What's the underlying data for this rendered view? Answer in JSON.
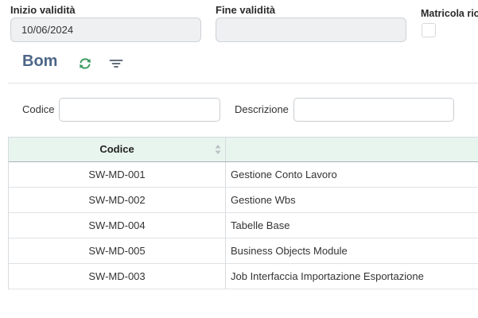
{
  "fields": {
    "start_label": "Inizio validità",
    "start_value": "10/06/2024",
    "end_label": "Fine validità",
    "end_value": "",
    "matricola_label": "Matricola rio"
  },
  "section": {
    "title": "Bom",
    "refresh_icon": "refresh-icon",
    "filter_icon": "filter-icon"
  },
  "filters": {
    "code_label": "Codice",
    "code_value": "",
    "desc_label": "Descrizione",
    "desc_value": ""
  },
  "table": {
    "columns": [
      "Codice",
      ""
    ],
    "rows": [
      {
        "code": "SW-MD-001",
        "desc": "Gestione Conto Lavoro"
      },
      {
        "code": "SW-MD-002",
        "desc": "Gestione Wbs"
      },
      {
        "code": "SW-MD-004",
        "desc": "Tabelle Base"
      },
      {
        "code": "SW-MD-005",
        "desc": "Business Objects Module"
      },
      {
        "code": "SW-MD-003",
        "desc": "Job Interfaccia Importazione Esportazione"
      }
    ]
  },
  "colors": {
    "title": "#4d6687",
    "refresh": "#3c9a5f",
    "header_bg": "#e8f4ee"
  }
}
